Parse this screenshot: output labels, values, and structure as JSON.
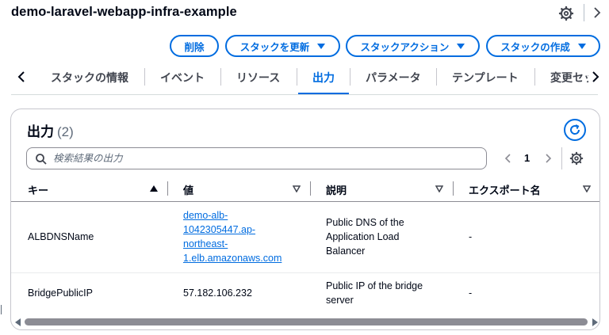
{
  "header": {
    "title": "demo-laravel-webapp-infra-example",
    "settings_icon": "gear-icon",
    "expand_icon": "chevron-right-icon"
  },
  "actions": {
    "delete_label": "削除",
    "update_label": "スタックを更新",
    "stack_actions_label": "スタックアクション",
    "create_label": "スタックの作成"
  },
  "tabs": [
    {
      "label": "スタックの情報"
    },
    {
      "label": "イベント"
    },
    {
      "label": "リソース"
    },
    {
      "label": "出力",
      "active": true
    },
    {
      "label": "パラメータ"
    },
    {
      "label": "テンプレート"
    },
    {
      "label": "変更セット"
    }
  ],
  "outputs": {
    "title": "出力",
    "count": "(2)",
    "search_placeholder": "検索結果の出力",
    "page": "1",
    "columns": {
      "key": "キー",
      "value": "値",
      "description": "説明",
      "export": "エクスポート名"
    },
    "rows": [
      {
        "key": "ALBDNSName",
        "value_lines": [
          "demo-alb-",
          "1042305447.ap-",
          "northeast-",
          "1.elb.amazonaws.com"
        ],
        "description_lines": [
          "Public DNS of the",
          "Application Load",
          "Balancer"
        ],
        "export": "-"
      },
      {
        "key": "BridgePublicIP",
        "value": "57.182.106.232",
        "description_lines": [
          "Public IP of the bridge",
          "server"
        ],
        "export": "-"
      }
    ]
  },
  "colors": {
    "accent": "#006ce0",
    "text": "#000716",
    "muted": "#5f6b7a"
  }
}
